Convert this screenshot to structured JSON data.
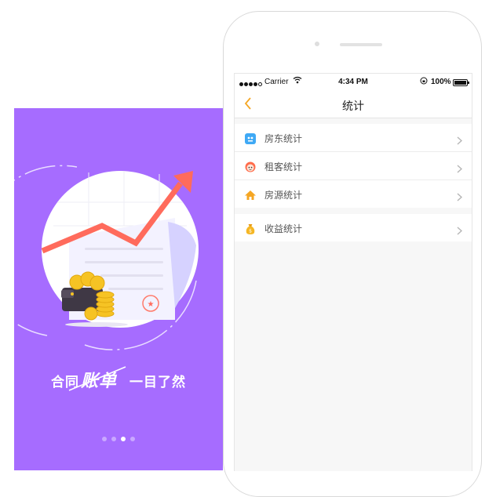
{
  "promo": {
    "slogan": {
      "part1": "合同",
      "part2": "账单",
      "part3": "一目了然"
    },
    "colors": {
      "background": "#a66cff",
      "arrow": "#ff6b5c",
      "coin": "#f6c324"
    },
    "pager": {
      "count": 4,
      "active_index": 2
    }
  },
  "phone": {
    "status_bar": {
      "carrier": "Carrier",
      "time": "4:34 PM",
      "battery": "100%"
    },
    "nav": {
      "title": "统计",
      "back_icon": "chevron-left-icon"
    },
    "groups": [
      {
        "items": [
          {
            "label": "房东统计",
            "icon": "landlord-icon",
            "color": "#3fa9f5"
          },
          {
            "label": "租客统计",
            "icon": "tenant-icon",
            "color": "#ff6b4a"
          },
          {
            "label": "房源统计",
            "icon": "house-icon",
            "color": "#f5a623"
          }
        ]
      },
      {
        "items": [
          {
            "label": "收益统计",
            "icon": "money-bag-icon",
            "color": "#f5b623"
          }
        ]
      }
    ]
  }
}
